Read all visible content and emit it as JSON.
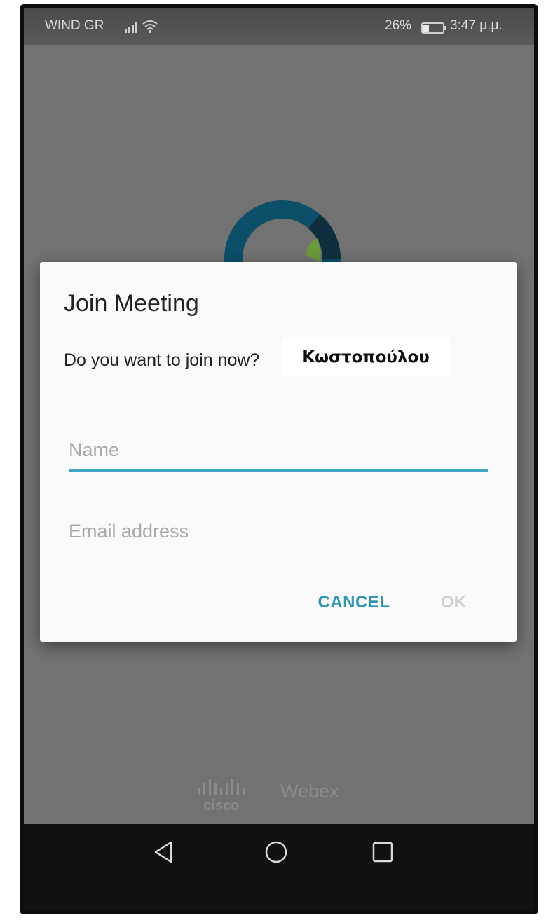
{
  "status_bar": {
    "carrier": "WIND GR",
    "battery_percent": "26%",
    "time": "3:47 μ.μ.",
    "icons": [
      "signal-icon",
      "wifi-icon",
      "battery-icon"
    ]
  },
  "app_logo": {
    "icon": "webex-logo-icon",
    "colors": [
      "#0b4f68",
      "#0f2f3f",
      "#6a9a3a"
    ]
  },
  "dialog": {
    "title": "Join Meeting",
    "message": "Do you want to join now?",
    "meeting_host_name": "Κωστοπούλου",
    "name_field": {
      "value": "",
      "placeholder": "Name"
    },
    "email_field": {
      "value": "",
      "placeholder": "Email address"
    },
    "cancel_label": "CANCEL",
    "ok_label": "OK",
    "accent_color": "#2f96b8"
  },
  "footer": {
    "brand": "cisco",
    "product": "Webex"
  },
  "nav_bar": {
    "icons": [
      "back-triangle-icon",
      "home-circle-icon",
      "recent-square-icon"
    ]
  }
}
